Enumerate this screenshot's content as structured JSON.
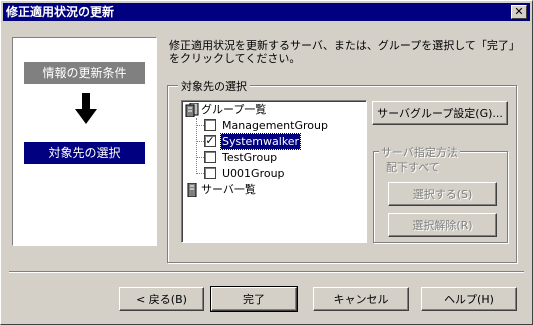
{
  "window": {
    "title": "修正適用状況の更新",
    "close_glyph": "✕"
  },
  "steps": [
    {
      "label": "情報の更新条件",
      "state": "done"
    },
    {
      "label": "対象先の選択",
      "state": "current"
    }
  ],
  "instructions": "修正適用状況を更新するサーバ、または、グループを選択して「完了」をクリックしてください。",
  "target_group": {
    "title": "対象先の選択",
    "tree": {
      "group_root": {
        "label": "グループ一覧",
        "icon": "server-group-icon"
      },
      "groups": [
        {
          "label": "ManagementGroup",
          "checked": false,
          "selected": false
        },
        {
          "label": "Systemwalker",
          "checked": true,
          "selected": true
        },
        {
          "label": "TestGroup",
          "checked": false,
          "selected": false
        },
        {
          "label": "U001Group",
          "checked": false,
          "selected": false
        }
      ],
      "server_root": {
        "label": "サーバ一覧",
        "icon": "server-icon"
      }
    },
    "server_group_settings_button": "サーバグループ設定(G)...",
    "server_spec": {
      "title": "サーバ指定方法",
      "subtitle": "配下すべて",
      "select_button": "選択する(S)",
      "deselect_button": "選択解除(R)"
    }
  },
  "footer": {
    "back": "< 戻る(B)",
    "finish": "完了",
    "cancel": "キャンセル",
    "help": "ヘルプ(H)"
  },
  "colors": {
    "dialog_bg": "#d4d0c8",
    "title_bar": "#000080",
    "current_step": "#000080",
    "done_step": "#808080"
  }
}
